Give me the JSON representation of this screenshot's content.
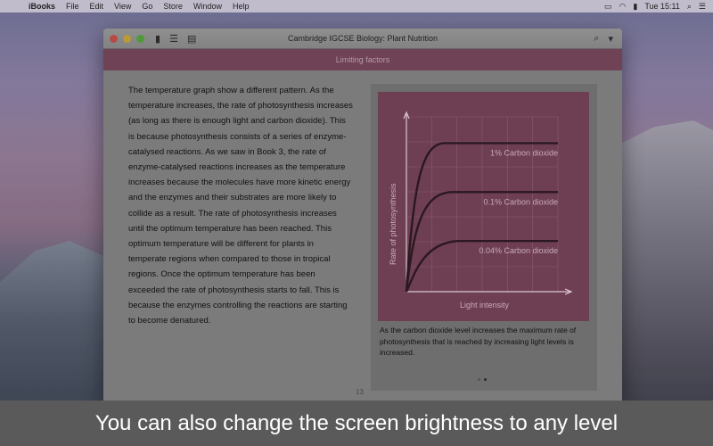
{
  "menubar": {
    "app_name": "iBooks",
    "items": [
      "File",
      "Edit",
      "View",
      "Go",
      "Store",
      "Window",
      "Help"
    ],
    "clock": "Tue 15:11"
  },
  "window": {
    "title": "Cambridge IGCSE Biology: Plant Nutrition",
    "chapter_title": "Limiting factors",
    "page_number": "13"
  },
  "body_text": "The temperature graph show a different pattern. As the temperature increases, the rate of photosynthesis increases (as long as there is enough light and carbon dioxide). This is because photosynthesis consists of a series of enzyme-catalysed reactions. As we saw in Book 3, the rate of enzyme-catalysed reactions increases as the temperature increases because the molecules have more kinetic energy and the enzymes and their substrates are more likely to collide as a result. The rate of photosynthesis increases until the optimum temperature has been reached. This optimum temperature will be different for plants in temperate regions when compared to those in tropical regions. Once the optimum temperature has been exceeded the rate of photosynthesis starts to fall. This is because the enzymes controlling the reactions are starting to become denatured.",
  "figure": {
    "caption": "As the carbon dioxide level increases the maximum rate of photosynthesis that is reached by increasing light levels is increased.",
    "pager": {
      "total": 2,
      "current": 2
    }
  },
  "chart_data": {
    "type": "line",
    "xlabel": "Light intensity",
    "ylabel": "Rate of photosynthesis",
    "series": [
      {
        "name": "1% Carbon dioxide",
        "plateau": 0.85
      },
      {
        "name": "0.1% Carbon dioxide",
        "plateau": 0.57
      },
      {
        "name": "0.04% Carbon dioxide",
        "plateau": 0.29
      }
    ],
    "grid": true,
    "colors": {
      "background": "#6e3f52",
      "grid": "#8a5a6d",
      "axis": "#d9c6cf",
      "curve": "#2b1820",
      "label": "#c7aab8"
    }
  },
  "banner": {
    "text": "You can also change the screen brightness to any level"
  }
}
